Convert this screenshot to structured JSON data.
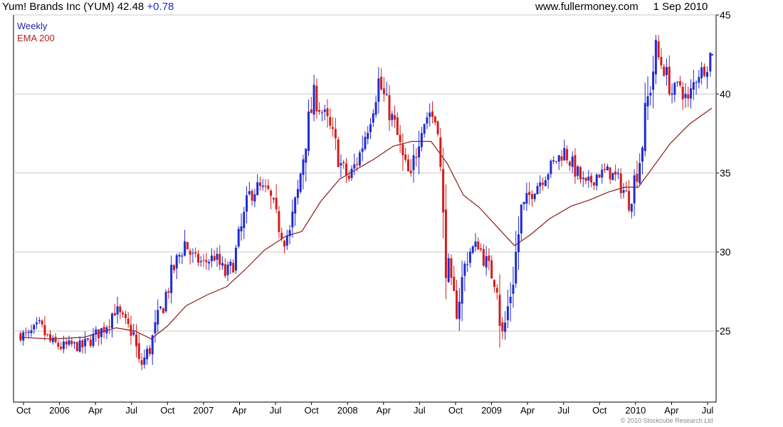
{
  "header": {
    "title": "Yum! Brands Inc (YUM) 42.48",
    "change": "+0.78",
    "source": "www.fullermoney.com",
    "date": "1 Sep 2010"
  },
  "legend": {
    "period": "Weekly",
    "ema": "EMA 200"
  },
  "footer": {
    "copyright": "© 2010 Stockcube Research Ltd"
  },
  "colors": {
    "up": "#1f2bd1",
    "down": "#d41c1c",
    "ema": "#8c1a1a",
    "grid": "#c8c8c8",
    "axis": "#000000"
  },
  "chart_data": {
    "type": "line",
    "title": "Yum! Brands Inc (YUM) 42.48",
    "ylim": [
      20.5,
      45
    ],
    "y_ticks": [
      25,
      30,
      35,
      40,
      45
    ],
    "x_ticks": [
      "Oct",
      "2006",
      "Apr",
      "Jul",
      "Oct",
      "2007",
      "Apr",
      "Jul",
      "Oct",
      "2008",
      "Apr",
      "Jul",
      "Oct",
      "2009",
      "Apr",
      "Jul",
      "Oct",
      "2010",
      "Apr",
      "Jul"
    ],
    "x_range": [
      "2005-09-26",
      "2010-09-01"
    ],
    "grid": true,
    "series": [
      {
        "name": "Weekly",
        "kind": "price",
        "points": [
          [
            "2005-09-26",
            24.8
          ],
          [
            "2005-10-24",
            24.7
          ],
          [
            "2005-11-21",
            25.3
          ],
          [
            "2005-12-19",
            24.3
          ],
          [
            "2006-01-16",
            24.0
          ],
          [
            "2006-02-13",
            24.1
          ],
          [
            "2006-03-13",
            24.0
          ],
          [
            "2006-04-10",
            24.6
          ],
          [
            "2006-05-08",
            25.2
          ],
          [
            "2006-06-05",
            26.4
          ],
          [
            "2006-07-03",
            25.4
          ],
          [
            "2006-07-24",
            24.8
          ],
          [
            "2006-08-07",
            22.6
          ],
          [
            "2006-09-04",
            23.9
          ],
          [
            "2006-10-02",
            26.2
          ],
          [
            "2006-11-06",
            29.0
          ],
          [
            "2006-12-04",
            30.6
          ],
          [
            "2006-12-25",
            29.6
          ],
          [
            "2007-01-22",
            29.3
          ],
          [
            "2007-02-19",
            29.7
          ],
          [
            "2007-03-19",
            28.6
          ],
          [
            "2007-04-09",
            29.2
          ],
          [
            "2007-04-30",
            31.4
          ],
          [
            "2007-05-21",
            33.5
          ],
          [
            "2007-06-11",
            34.1
          ],
          [
            "2007-07-09",
            33.8
          ],
          [
            "2007-07-30",
            32.0
          ],
          [
            "2007-08-20",
            30.9
          ],
          [
            "2007-09-03",
            31.2
          ],
          [
            "2007-09-24",
            33.7
          ],
          [
            "2007-10-15",
            37.5
          ],
          [
            "2007-11-05",
            39.7
          ],
          [
            "2007-12-03",
            38.6
          ],
          [
            "2007-12-24",
            37.3
          ],
          [
            "2008-01-14",
            35.5
          ],
          [
            "2008-02-04",
            34.6
          ],
          [
            "2008-03-03",
            36.2
          ],
          [
            "2008-03-24",
            38.1
          ],
          [
            "2008-04-21",
            40.8
          ],
          [
            "2008-05-12",
            39.3
          ],
          [
            "2008-06-02",
            38.0
          ],
          [
            "2008-06-23",
            35.8
          ],
          [
            "2008-07-14",
            34.5
          ],
          [
            "2008-08-04",
            37.7
          ],
          [
            "2008-09-01",
            38.9
          ],
          [
            "2008-09-22",
            38.0
          ],
          [
            "2008-10-06",
            31.5
          ],
          [
            "2008-10-20",
            28.2
          ],
          [
            "2008-11-10",
            26.4
          ],
          [
            "2008-12-08",
            29.9
          ],
          [
            "2009-01-05",
            30.5
          ],
          [
            "2009-01-26",
            29.3
          ],
          [
            "2009-02-23",
            27.9
          ],
          [
            "2009-03-09",
            24.4
          ],
          [
            "2009-04-06",
            28.5
          ],
          [
            "2009-04-27",
            32.5
          ],
          [
            "2009-05-25",
            33.9
          ],
          [
            "2009-06-22",
            34.7
          ],
          [
            "2009-07-20",
            35.6
          ],
          [
            "2009-08-17",
            36.4
          ],
          [
            "2009-09-14",
            35.2
          ],
          [
            "2009-10-12",
            34.1
          ],
          [
            "2009-11-09",
            34.9
          ],
          [
            "2009-12-07",
            35.1
          ],
          [
            "2010-01-04",
            34.6
          ],
          [
            "2010-02-01",
            33.2
          ],
          [
            "2010-03-01",
            35.9
          ],
          [
            "2010-03-22",
            39.6
          ],
          [
            "2010-04-12",
            42.6
          ],
          [
            "2010-05-03",
            41.6
          ],
          [
            "2010-05-24",
            40.1
          ],
          [
            "2010-06-14",
            40.6
          ],
          [
            "2010-07-05",
            39.4
          ],
          [
            "2010-07-26",
            41.2
          ],
          [
            "2010-08-16",
            41.6
          ],
          [
            "2010-09-01",
            42.48
          ]
        ]
      },
      {
        "name": "EMA 200",
        "kind": "ema",
        "points": [
          [
            "2005-09-26",
            24.6
          ],
          [
            "2005-12-19",
            24.5
          ],
          [
            "2006-03-13",
            24.6
          ],
          [
            "2006-06-05",
            25.2
          ],
          [
            "2006-07-24",
            25.0
          ],
          [
            "2006-09-04",
            24.5
          ],
          [
            "2006-10-16",
            25.3
          ],
          [
            "2006-12-04",
            26.6
          ],
          [
            "2007-01-29",
            27.3
          ],
          [
            "2007-03-19",
            27.8
          ],
          [
            "2007-05-07",
            28.9
          ],
          [
            "2007-06-25",
            30.1
          ],
          [
            "2007-08-20",
            31.0
          ],
          [
            "2007-10-01",
            31.3
          ],
          [
            "2007-11-19",
            33.2
          ],
          [
            "2008-01-07",
            34.6
          ],
          [
            "2008-02-18",
            35.2
          ],
          [
            "2008-04-07",
            35.9
          ],
          [
            "2008-05-26",
            36.7
          ],
          [
            "2008-07-14",
            37.0
          ],
          [
            "2008-09-01",
            37.0
          ],
          [
            "2008-10-13",
            35.6
          ],
          [
            "2008-11-24",
            33.6
          ],
          [
            "2009-01-05",
            32.8
          ],
          [
            "2009-02-23",
            31.5
          ],
          [
            "2009-04-06",
            30.4
          ],
          [
            "2009-05-18",
            31.1
          ],
          [
            "2009-07-06",
            32.1
          ],
          [
            "2009-08-31",
            32.9
          ],
          [
            "2009-10-19",
            33.3
          ],
          [
            "2009-12-07",
            33.8
          ],
          [
            "2010-01-18",
            34.1
          ],
          [
            "2010-02-22",
            34.1
          ],
          [
            "2010-04-05",
            35.5
          ],
          [
            "2010-05-17",
            36.9
          ],
          [
            "2010-07-05",
            38.1
          ],
          [
            "2010-09-01",
            39.1
          ]
        ]
      }
    ]
  }
}
